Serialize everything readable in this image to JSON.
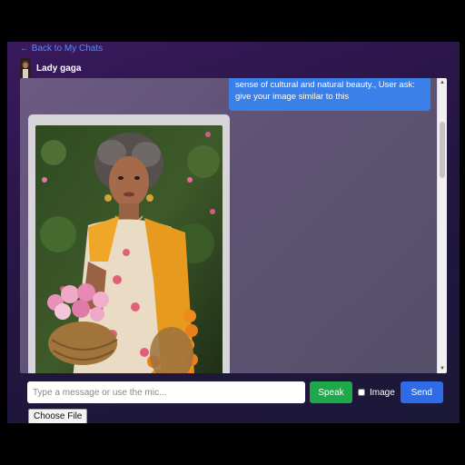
{
  "nav": {
    "back_label": "← Back to My Chats"
  },
  "header": {
    "name": "Lady gaga",
    "avatar_icon": "avatar-portrait"
  },
  "messages": {
    "user_text": "sense of cultural and natural beauty., User ask: give your image similar to this",
    "bot_image_icon": "generated-portrait-image"
  },
  "composer": {
    "placeholder": "Type a message or use the mic...",
    "value": "",
    "speak_label": "Speak",
    "image_label": "Image",
    "image_checked": false,
    "send_label": "Send",
    "file_label": "Choose File"
  },
  "colors": {
    "link": "#4d8dff",
    "user_bubble": "#3b7fe8",
    "speak": "#1ea84a",
    "send": "#2e6be6"
  }
}
